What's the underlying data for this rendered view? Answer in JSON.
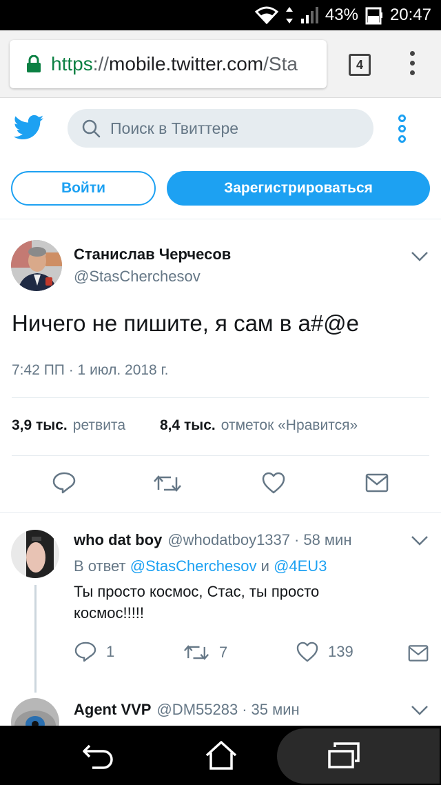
{
  "status_bar": {
    "battery": "43%",
    "time": "20:47"
  },
  "browser": {
    "url_scheme": "https",
    "url_sep": "://",
    "url_host": "mobile.twitter.com",
    "url_path": "/Sta",
    "tab_count": "4"
  },
  "header": {
    "search_placeholder": "Поиск в Твиттере",
    "login_label": "Войти",
    "signup_label": "Зарегистрироваться"
  },
  "tweet": {
    "author_name": "Станислав Черчесов",
    "author_handle": "@StasCherchesov",
    "text": "Ничего не пишите, я сам в а#@е",
    "timestamp": "7:42 ПП · 1 июл. 2018 г.",
    "retweets_count": "3,9 тыс.",
    "retweets_label": "ретвита",
    "likes_count": "8,4 тыс.",
    "likes_label": "отметок «Нравится»"
  },
  "replies": [
    {
      "name": "who dat boy",
      "handle": "@whodatboy1337",
      "sep": "·",
      "time": "58 мин",
      "in_reply_prefix": "В ответ",
      "mention_1": "@StasCherchesov",
      "in_reply_and": "и",
      "mention_2": "@4EU3",
      "text": "Ты просто космос, Стас, ты просто космос!!!!!",
      "reply_count": "1",
      "retweet_count": "7",
      "like_count": "139"
    },
    {
      "name": "Agent VVP",
      "handle": "@DM55283",
      "sep": "·",
      "time": "35 мин"
    }
  ],
  "colors": {
    "twitter_blue": "#1da1f2",
    "secondary_text": "#657786",
    "lock_green": "#0b8043"
  }
}
